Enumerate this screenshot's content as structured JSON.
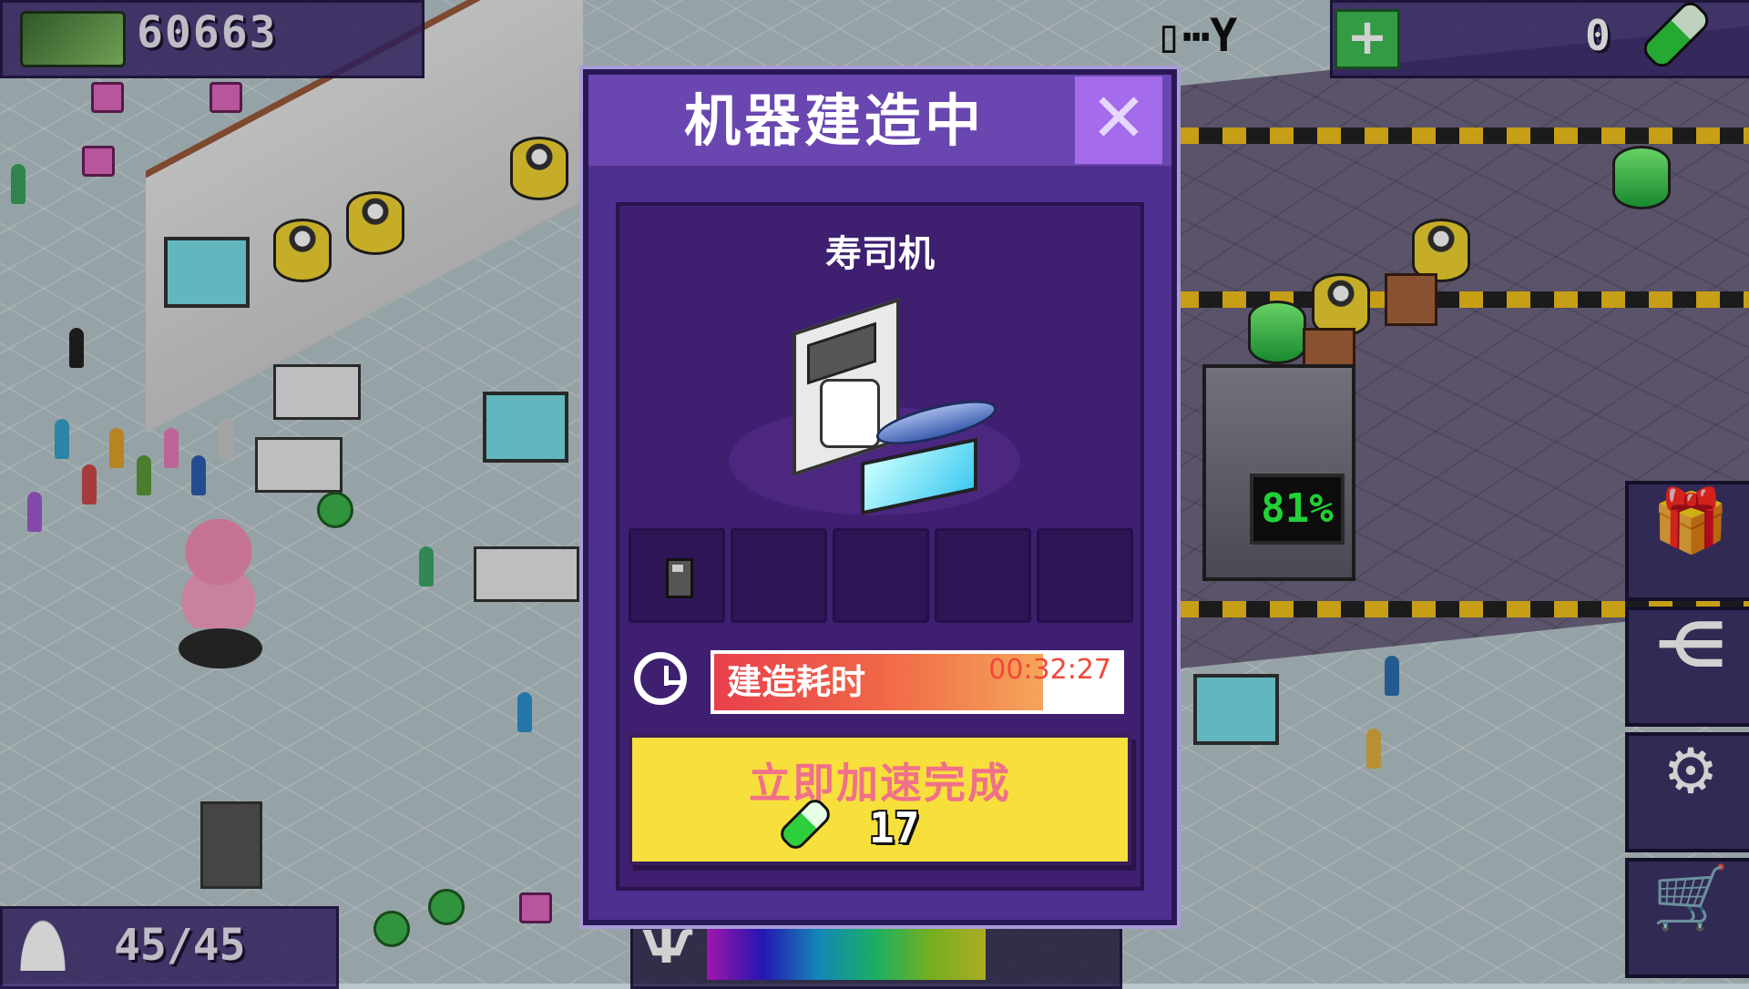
{
  "hud": {
    "money": "60663",
    "population": "45/45",
    "cells": "0"
  },
  "world": {
    "machine_display_percent": "81%"
  },
  "modal": {
    "title": "机器建造中",
    "close_label": "✕",
    "machine_name": "寿司机",
    "slots": [
      "floppy-disk",
      "",
      "",
      "",
      ""
    ],
    "build_time_label": "建造耗时",
    "remaining_time": "00:32:27",
    "progress_fraction": 0.81,
    "boost_label": "立即加速完成",
    "boost_cost": "17"
  },
  "icons": {
    "money": "cash-icon",
    "plus": "plus-icon",
    "battery": "battery-icon",
    "signal": "signal-icon",
    "avatar": "person-icon",
    "mood": "cheer-icon",
    "gift": "gift-icon",
    "share": "share-icon",
    "settings": "gear-icon",
    "shop": "cart-icon",
    "clock": "clock-icon"
  },
  "colors": {
    "modal_bg": "#4f2f8f",
    "header": "#6a47b0",
    "close": "#a46bea",
    "boost_button": "#f8e03c",
    "progress_start": "#e9404d",
    "progress_end": "#f5a55a"
  }
}
